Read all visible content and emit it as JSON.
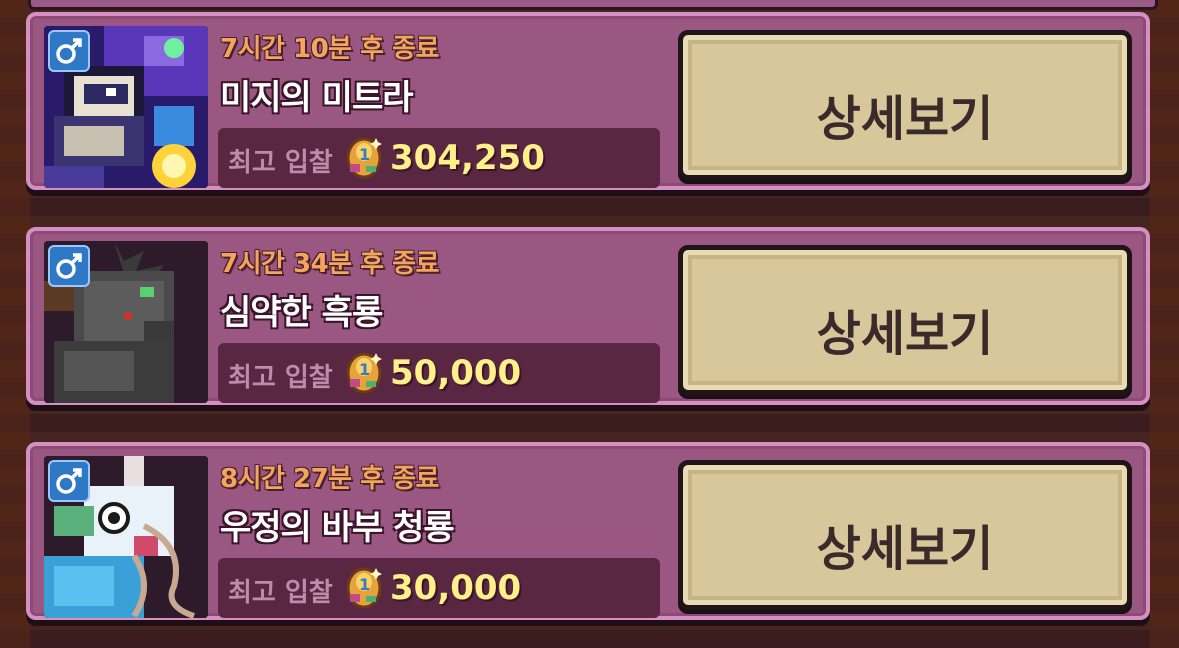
{
  "auctions": [
    {
      "timer": "7시간 10분 후 종료",
      "name": "미지의 미트라",
      "bid_label": "최고 입찰",
      "bid_value": "304,250",
      "button_label": "상세보기",
      "gender_icon": "male-icon"
    },
    {
      "timer": "7시간 34분 후 종료",
      "name": "심약한 흑룡",
      "bid_label": "최고 입찰",
      "bid_value": "50,000",
      "button_label": "상세보기",
      "gender_icon": "male-icon"
    },
    {
      "timer": "8시간 27분 후 종료",
      "name": "우정의 바부 청룡",
      "bid_label": "최고 입찰",
      "bid_value": "30,000",
      "button_label": "상세보기",
      "gender_icon": "male-icon"
    }
  ],
  "colors": {
    "card_bg": "#9a5782",
    "card_border": "#d58fc0",
    "timer": "#f3a55b",
    "bid_value": "#fff08a",
    "button_bg": "#d8c79b",
    "gender_badge": "#2f78c6"
  }
}
